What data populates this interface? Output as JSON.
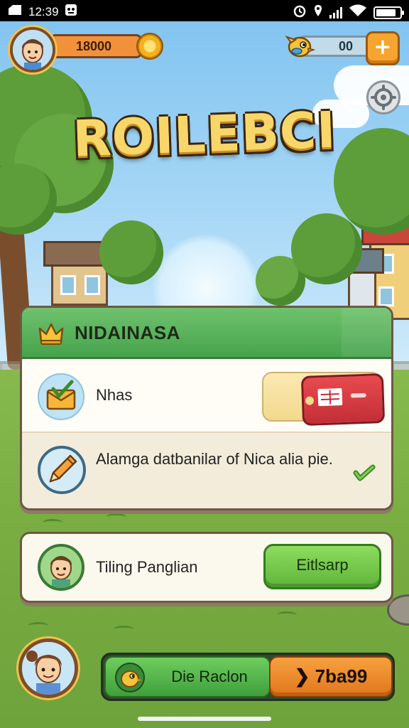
{
  "status_bar": {
    "time": "12:39",
    "battery_level": 0.85,
    "icons": [
      "sim-icon",
      "notification-icon",
      "alarm-icon",
      "location-icon",
      "signal-icon",
      "wifi-icon",
      "battery-icon"
    ]
  },
  "hud": {
    "coins": "18000",
    "gems": "00",
    "plus_label": "+"
  },
  "title": "ROILEBCI",
  "panel": {
    "header_title": "NIDAINASA",
    "row1_label": "Nhas",
    "row2_text": "Alamga datbanilar of Nica alia pie."
  },
  "friend": {
    "name": "Tiling Panglian",
    "button_label": "Eitlsarp"
  },
  "bottom_bar": {
    "mode_label": "Die Raclon",
    "play_label": "❯ 7ba99"
  },
  "colors": {
    "header_green": "#47a34d",
    "accent_orange": "#f1913a",
    "ticket_red": "#c32f37",
    "button_green": "#5fb53a",
    "outline_brown": "#6b5a45"
  }
}
